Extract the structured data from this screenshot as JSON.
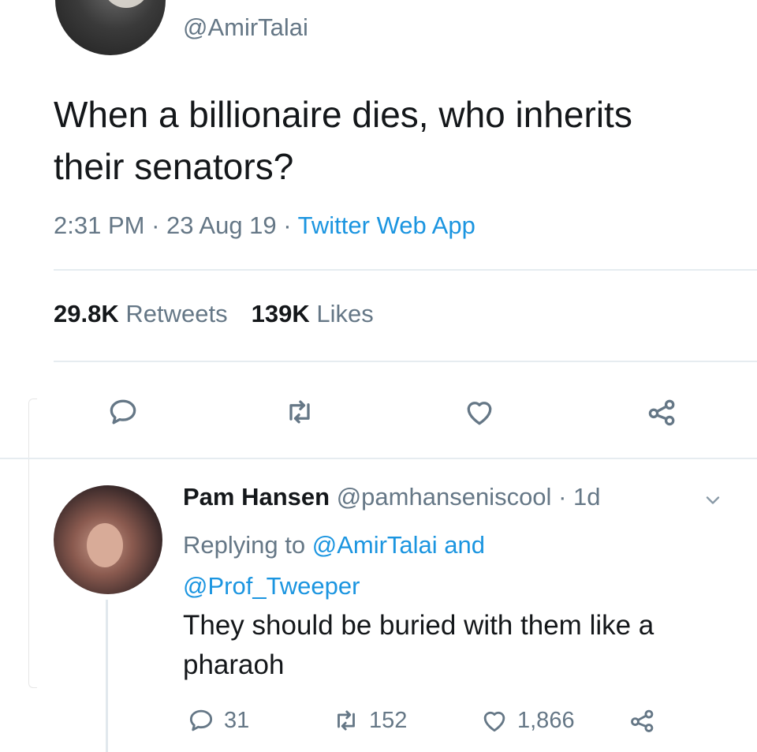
{
  "tweet": {
    "handle": "@AmirTalai",
    "text": "When a billionaire dies, who inherits their senators?",
    "time": "2:31 PM",
    "date": "23 Aug 19",
    "source": "Twitter Web App",
    "retweets_count": "29.8K",
    "retweets_label": "Retweets",
    "likes_count": "139K",
    "likes_label": "Likes"
  },
  "reply": {
    "name": "Pam Hansen",
    "handle": "@pamhanseniscool",
    "age": "1d",
    "replying_prefix": "Replying to",
    "mention_1": "@AmirTalai",
    "and_word": "and",
    "mention_2": "@Prof_Tweeper",
    "text": "They should be buried with them like a pharaoh",
    "reply_count": "31",
    "retweet_count": "152",
    "like_count": "1,866"
  },
  "icons": [
    "reply-icon",
    "retweet-icon",
    "like-icon",
    "share-icon",
    "chevron-down-icon"
  ],
  "colors": {
    "accent": "#1b95e0",
    "secondary_text": "#657786",
    "primary_text": "#14171a"
  }
}
